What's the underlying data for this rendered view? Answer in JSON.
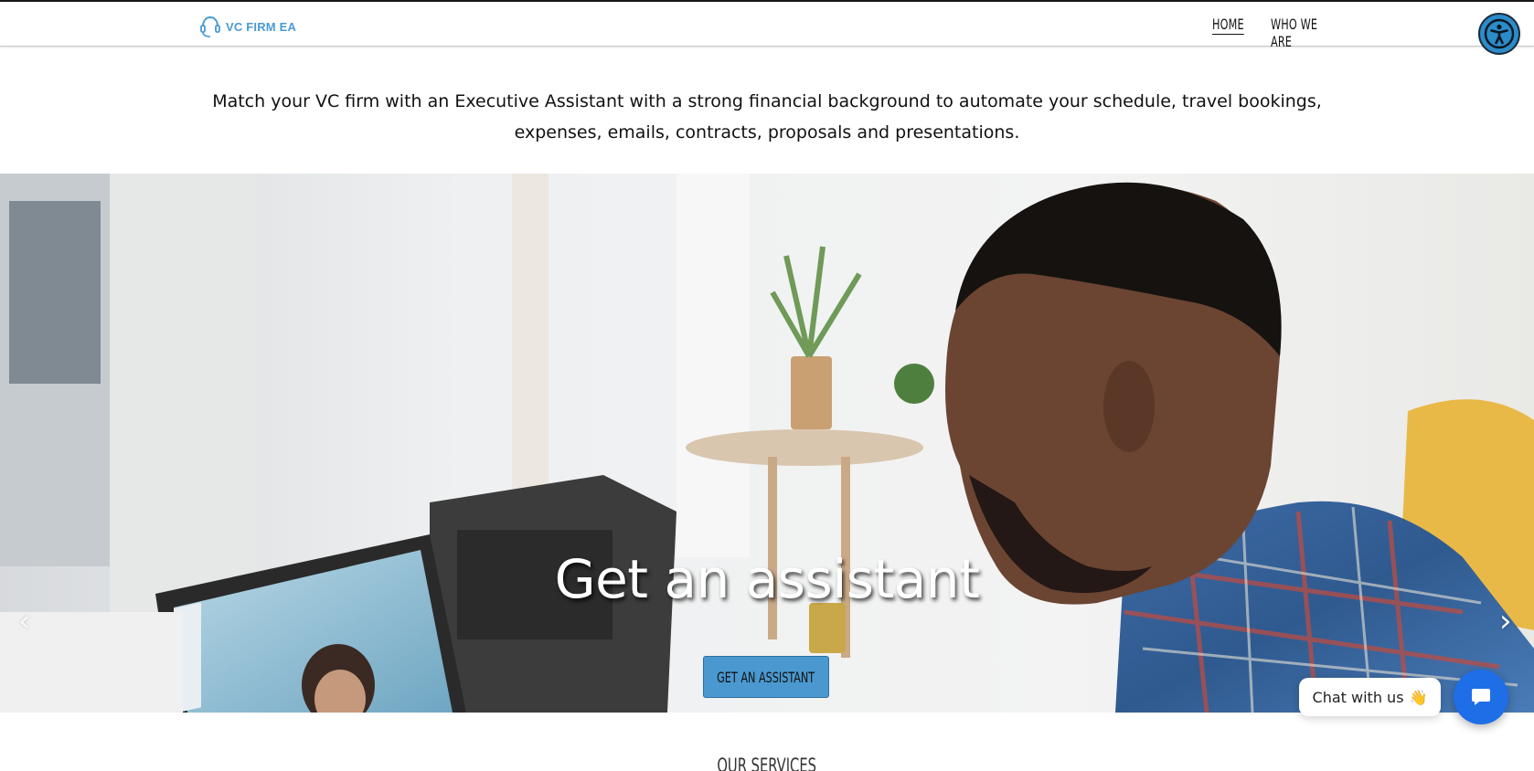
{
  "header": {
    "logo_text": "VC FIRM EA",
    "nav": [
      {
        "label": "HOME",
        "active": true
      },
      {
        "label": "WHO WE ARE",
        "active": false
      }
    ]
  },
  "accessibility": {
    "icon": "accessibility-icon",
    "color": "#2a8cc9"
  },
  "intro": {
    "line1": "Match your VC firm with an Executive Assistant with a strong financial background to automate your schedule, travel bookings,",
    "line2": "expenses, emails, contracts, proposals and presentations."
  },
  "hero": {
    "title": "Get an assistant",
    "button_label": "GET AN ASSISTANT",
    "prev_icon": "‹",
    "next_icon": "›",
    "button_color": "#4a98cf"
  },
  "services": {
    "heading": "OUR SERVICES"
  },
  "chat": {
    "label": "Chat with us",
    "emoji": "👋",
    "button_color": "#1e6ee8"
  },
  "colors": {
    "brand": "#4a9ad4"
  }
}
